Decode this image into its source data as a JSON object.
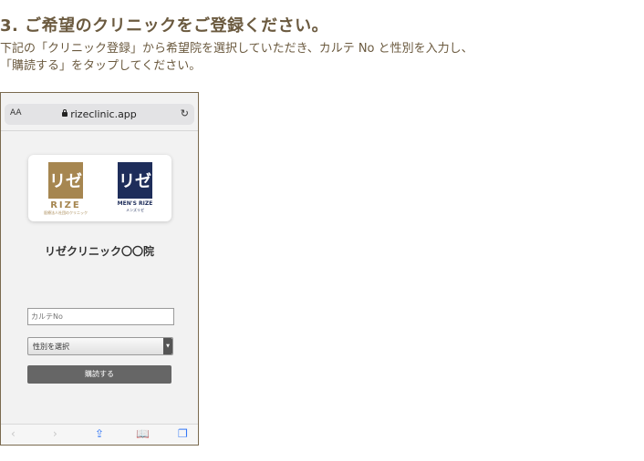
{
  "heading": "3. ご希望のクリニックをご登録ください。",
  "description": {
    "line1": "下記の「クリニック登録」から希望院を選択していただき、カルテ No と性別を入力し、",
    "line2": "「購読する」をタップしてください。"
  },
  "browser": {
    "text_size_label": "AA",
    "url": "rizeclinic.app",
    "reload_icon": "↻"
  },
  "logos": {
    "rize": {
      "mark": "リゼ",
      "name": "RIZE",
      "sub": "医療法人社団のクリニック"
    },
    "mens_rize": {
      "mark": "リゼ",
      "name": "MEN'S RIZE",
      "sub": "メンズリゼ"
    }
  },
  "clinic_name": "リゼクリニック〇〇院",
  "form": {
    "karte_placeholder": "カルテNo",
    "gender_select_label": "性別を選択",
    "submit_label": "購読する"
  },
  "toolbar": {
    "back": "‹",
    "forward": "›",
    "share": "⇪",
    "bookmarks": "📖",
    "tabs": "❐"
  },
  "colors": {
    "brand_text": "#6b5a3f",
    "rize_gold": "#a68650",
    "mens_rize_navy": "#1e2d5a",
    "ios_blue": "#3478f6"
  }
}
